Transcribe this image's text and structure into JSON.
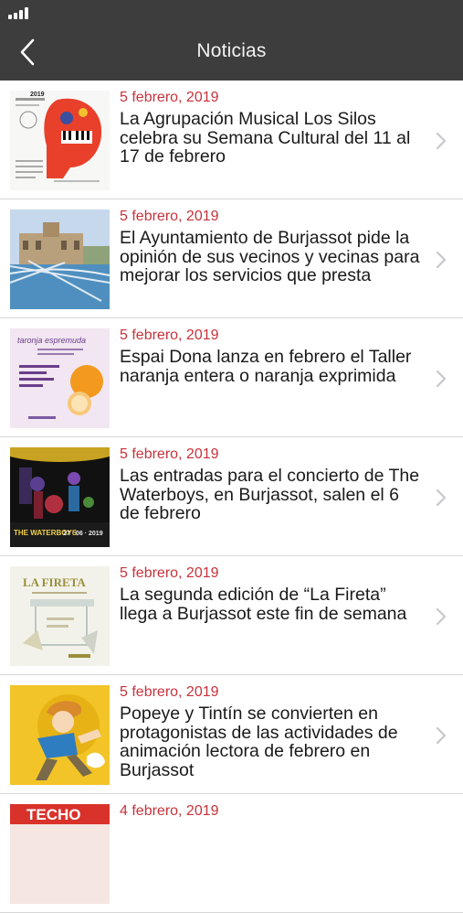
{
  "header": {
    "title": "Noticias"
  },
  "icons": {
    "back": "chevron-left-icon",
    "row_arrow": "chevron-right-icon",
    "signal": "signal-icon"
  },
  "colors": {
    "header_bg": "#3d3d3d",
    "date": "#c8323a",
    "divider": "#d6d6d6"
  },
  "news": [
    {
      "date": "5 febrero, 2019",
      "title": "La Agrupación Musical Los Silos celebra su Semana Cultural del 11 al 17 de febrero",
      "thumb_text": [
        "2019"
      ]
    },
    {
      "date": "5 febrero, 2019",
      "title": "El Ayuntamiento de Burjassot pide la opinión de sus vecinos y vecinas para mejorar los servicios que presta",
      "thumb_text": []
    },
    {
      "date": "5 febrero, 2019",
      "title": "Espai Dona lanza en febrero el Taller naranja entera o naranja exprimida",
      "thumb_text": [
        "taronja espremuda"
      ]
    },
    {
      "date": "5 febrero, 2019",
      "title": "Las entradas para el concierto de The Waterboys, en Burjassot, salen el 6 de febrero",
      "thumb_text": [
        "THE WATERBOYS",
        "27 · 06 · 2019"
      ]
    },
    {
      "date": "5 febrero, 2019",
      "title": "La segunda edición de “La Fireta” llega a Burjassot este fin de semana",
      "thumb_text": [
        "LA FIRETA"
      ]
    },
    {
      "date": "5 febrero, 2019",
      "title": "Popeye y Tintín se convierten en protagonistas de las actividades de animación lectora de febrero en Burjassot",
      "thumb_text": []
    },
    {
      "date": "4 febrero, 2019",
      "title": "",
      "thumb_text": [
        "TECHO"
      ]
    }
  ]
}
